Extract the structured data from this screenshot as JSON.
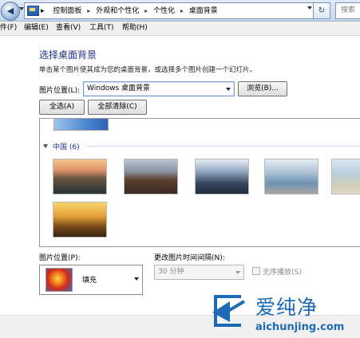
{
  "address_bar": {
    "nav_icon": "back-forward-icon",
    "breadcrumbs": [
      "控制面板",
      "外观和个性化",
      "个性化",
      "桌面背景"
    ],
    "separator": "▸",
    "search_placeholder": "搜索",
    "refresh_glyph": "↻"
  },
  "menu": {
    "items": [
      "件(F)",
      "编辑(E)",
      "查看(V)",
      "工具(T)",
      "帮助(H)"
    ]
  },
  "main": {
    "title": "选择桌面背景",
    "subtitle": "单击某个图片使其成为您的桌面背景，或选择多个图片创建一个幻灯片。",
    "picture_location_label": "图片位置(L):",
    "picture_location_value": "Windows 桌面背景",
    "browse_label": "浏览(B)...",
    "select_all_label": "全选(A)",
    "clear_all_label": "全部清除(C)",
    "group_name": "中国 (6)",
    "thumbnails": [
      "thumbnail-1",
      "thumbnail-2",
      "thumbnail-3",
      "thumbnail-4",
      "thumbnail-5",
      "thumbnail-6"
    ]
  },
  "bottom": {
    "position_label": "图片位置(P):",
    "position_value": "填充",
    "interval_label": "更改图片时间间隔(N):",
    "interval_value": "30 分钟",
    "shuffle_label": "无序播放(S)",
    "shuffle_checked": false
  },
  "watermark": {
    "text_cn": "爱纯净",
    "url": "aichunjing.com"
  },
  "colors": {
    "title_blue": "#1e3287",
    "watermark_blue": "#1e6bb5"
  }
}
